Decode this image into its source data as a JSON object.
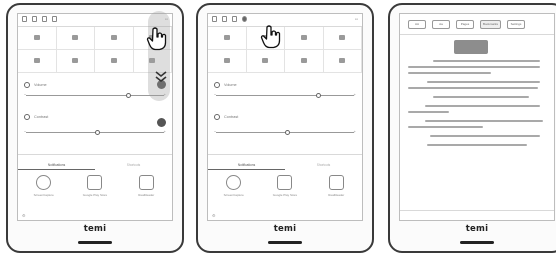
{
  "devices": [
    {
      "brand": "temi",
      "tabs": [
        "Notifications",
        "Shortcuts"
      ],
      "sliders": [
        {
          "label": "Volume",
          "value_fraction": 0.72
        },
        {
          "label": "Contrast",
          "value_fraction": 0.5
        }
      ],
      "apps": [
        {
          "icon": "camera-icon",
          "label": "ScreenCapture"
        },
        {
          "icon": "play-icon",
          "label": "Google Play Store"
        },
        {
          "icon": "page-icon",
          "label": "RealReader"
        }
      ]
    },
    {
      "brand": "temi",
      "tabs": [
        "Notifications",
        "Shortcuts"
      ],
      "sliders": [
        {
          "label": "Volume",
          "value_fraction": 0.72
        },
        {
          "label": "Contrast",
          "value_fraction": 0.5
        }
      ],
      "apps": [
        {
          "icon": "camera-icon",
          "label": "ScreenCapture"
        },
        {
          "icon": "play-icon",
          "label": "Google Play Store"
        },
        {
          "icon": "page-icon",
          "label": "RealReader"
        }
      ]
    },
    {
      "brand": "temi",
      "reader_tabs": [
        "AA",
        "Aa",
        "Pages",
        "Bookmarks",
        "Settings"
      ]
    }
  ],
  "overlay": {
    "pointer": "hand-icon",
    "gesture": "swipe-down-icon"
  }
}
